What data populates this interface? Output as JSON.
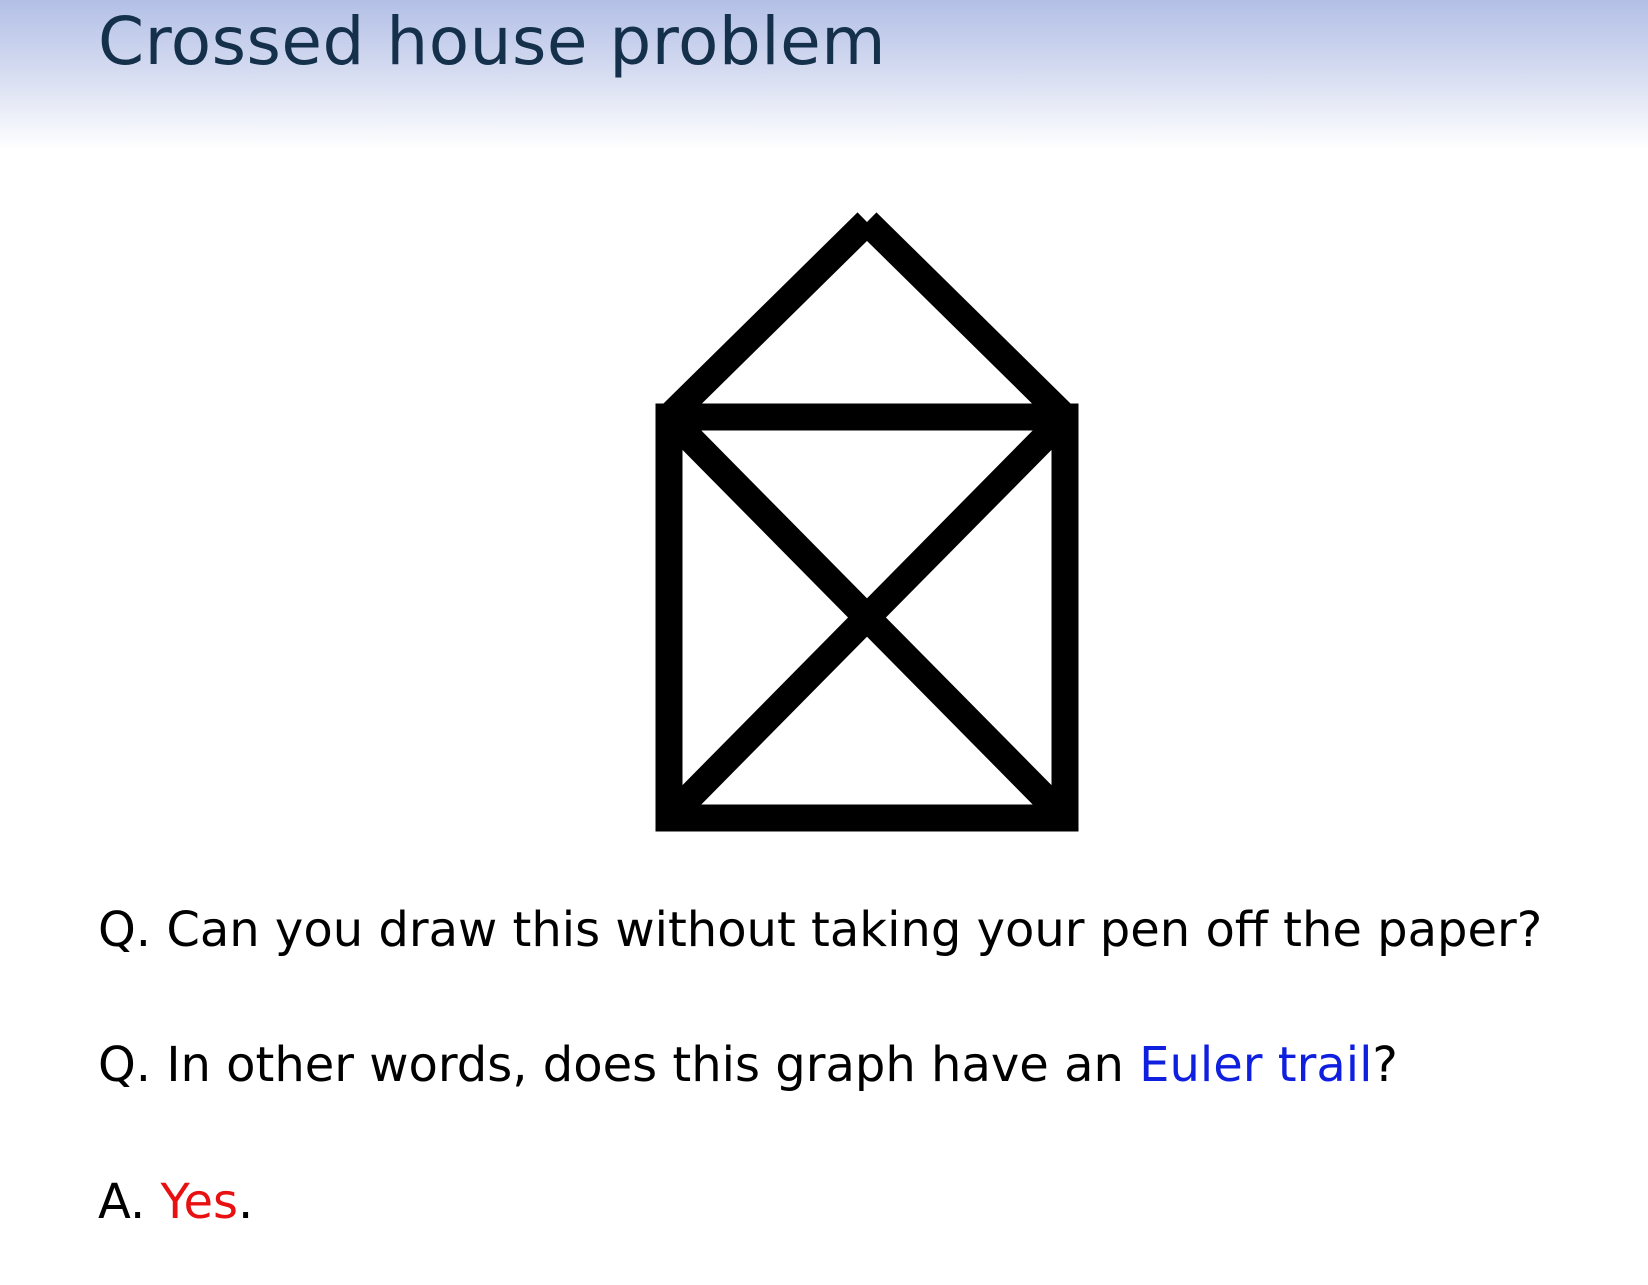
{
  "slide": {
    "title": "Crossed house problem"
  },
  "questions": [
    {
      "prefix": "Q.",
      "text": "Can you draw this without taking your pen off the paper?"
    },
    {
      "prefix": "Q.",
      "text_before": "In other words, does this graph have an",
      "highlight": "Euler trail",
      "text_after": "?"
    }
  ],
  "answer": {
    "prefix": "A.",
    "highlight": "Yes",
    "text_after": "."
  },
  "colors": {
    "title": "#14304a",
    "highlight_blue": "#0f1fe0",
    "highlight_red": "#e81010",
    "drawing": "#000000"
  }
}
